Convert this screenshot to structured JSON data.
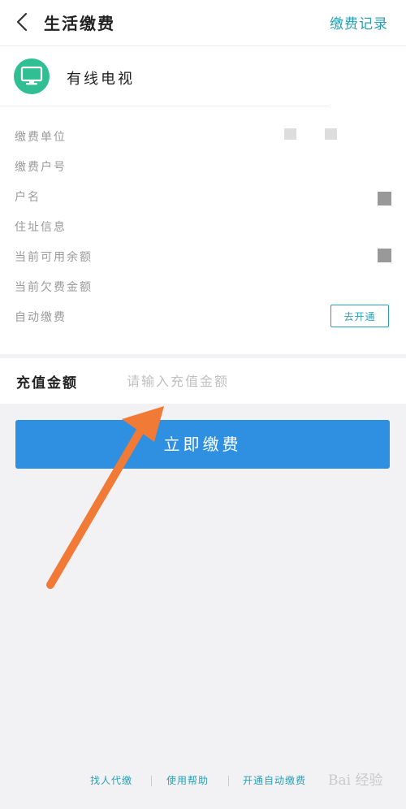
{
  "header": {
    "title": "生活缴费",
    "right_link": "缴费记录"
  },
  "service": {
    "name": "有线电视",
    "icon": "tv-icon",
    "icon_color": "#2fbf93"
  },
  "info": {
    "rows": [
      {
        "label": "缴费单位"
      },
      {
        "label": "缴费户号"
      },
      {
        "label": "户名"
      },
      {
        "label": "住址信息"
      },
      {
        "label": "当前可用余额"
      },
      {
        "label": "当前欠费金额"
      },
      {
        "label": "自动缴费"
      }
    ],
    "enable_button": "去开通"
  },
  "amount": {
    "label": "充值金额",
    "placeholder": "请输入充值金额",
    "value": ""
  },
  "pay_button": "立即缴费",
  "footer": {
    "links": [
      "找人代缴",
      "使用帮助",
      "开通自动缴费"
    ]
  },
  "watermark": "Bai 经验",
  "colors": {
    "accent": "#2a9fb4",
    "primary_button": "#2f8fe0",
    "arrow": "#f07a36"
  }
}
